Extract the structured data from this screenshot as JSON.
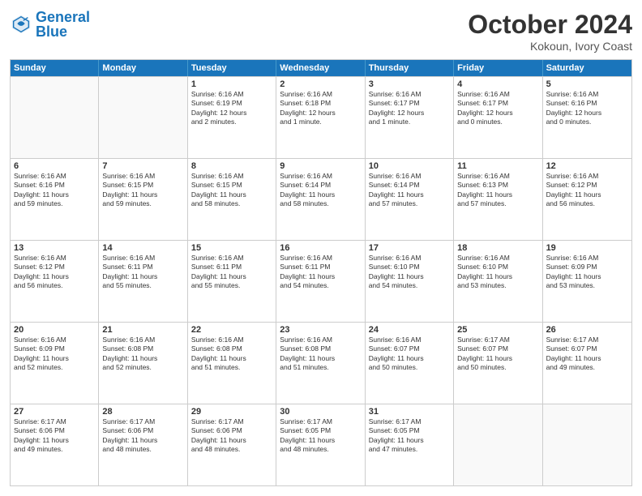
{
  "logo": {
    "line1": "General",
    "line2": "Blue"
  },
  "title": "October 2024",
  "subtitle": "Kokoun, Ivory Coast",
  "header_days": [
    "Sunday",
    "Monday",
    "Tuesday",
    "Wednesday",
    "Thursday",
    "Friday",
    "Saturday"
  ],
  "rows": [
    [
      {
        "day": "",
        "text": "",
        "empty": true
      },
      {
        "day": "",
        "text": "",
        "empty": true
      },
      {
        "day": "1",
        "text": "Sunrise: 6:16 AM\nSunset: 6:19 PM\nDaylight: 12 hours\nand 2 minutes."
      },
      {
        "day": "2",
        "text": "Sunrise: 6:16 AM\nSunset: 6:18 PM\nDaylight: 12 hours\nand 1 minute."
      },
      {
        "day": "3",
        "text": "Sunrise: 6:16 AM\nSunset: 6:17 PM\nDaylight: 12 hours\nand 1 minute."
      },
      {
        "day": "4",
        "text": "Sunrise: 6:16 AM\nSunset: 6:17 PM\nDaylight: 12 hours\nand 0 minutes."
      },
      {
        "day": "5",
        "text": "Sunrise: 6:16 AM\nSunset: 6:16 PM\nDaylight: 12 hours\nand 0 minutes."
      }
    ],
    [
      {
        "day": "6",
        "text": "Sunrise: 6:16 AM\nSunset: 6:16 PM\nDaylight: 11 hours\nand 59 minutes."
      },
      {
        "day": "7",
        "text": "Sunrise: 6:16 AM\nSunset: 6:15 PM\nDaylight: 11 hours\nand 59 minutes."
      },
      {
        "day": "8",
        "text": "Sunrise: 6:16 AM\nSunset: 6:15 PM\nDaylight: 11 hours\nand 58 minutes."
      },
      {
        "day": "9",
        "text": "Sunrise: 6:16 AM\nSunset: 6:14 PM\nDaylight: 11 hours\nand 58 minutes."
      },
      {
        "day": "10",
        "text": "Sunrise: 6:16 AM\nSunset: 6:14 PM\nDaylight: 11 hours\nand 57 minutes."
      },
      {
        "day": "11",
        "text": "Sunrise: 6:16 AM\nSunset: 6:13 PM\nDaylight: 11 hours\nand 57 minutes."
      },
      {
        "day": "12",
        "text": "Sunrise: 6:16 AM\nSunset: 6:12 PM\nDaylight: 11 hours\nand 56 minutes."
      }
    ],
    [
      {
        "day": "13",
        "text": "Sunrise: 6:16 AM\nSunset: 6:12 PM\nDaylight: 11 hours\nand 56 minutes."
      },
      {
        "day": "14",
        "text": "Sunrise: 6:16 AM\nSunset: 6:11 PM\nDaylight: 11 hours\nand 55 minutes."
      },
      {
        "day": "15",
        "text": "Sunrise: 6:16 AM\nSunset: 6:11 PM\nDaylight: 11 hours\nand 55 minutes."
      },
      {
        "day": "16",
        "text": "Sunrise: 6:16 AM\nSunset: 6:11 PM\nDaylight: 11 hours\nand 54 minutes."
      },
      {
        "day": "17",
        "text": "Sunrise: 6:16 AM\nSunset: 6:10 PM\nDaylight: 11 hours\nand 54 minutes."
      },
      {
        "day": "18",
        "text": "Sunrise: 6:16 AM\nSunset: 6:10 PM\nDaylight: 11 hours\nand 53 minutes."
      },
      {
        "day": "19",
        "text": "Sunrise: 6:16 AM\nSunset: 6:09 PM\nDaylight: 11 hours\nand 53 minutes."
      }
    ],
    [
      {
        "day": "20",
        "text": "Sunrise: 6:16 AM\nSunset: 6:09 PM\nDaylight: 11 hours\nand 52 minutes."
      },
      {
        "day": "21",
        "text": "Sunrise: 6:16 AM\nSunset: 6:08 PM\nDaylight: 11 hours\nand 52 minutes."
      },
      {
        "day": "22",
        "text": "Sunrise: 6:16 AM\nSunset: 6:08 PM\nDaylight: 11 hours\nand 51 minutes."
      },
      {
        "day": "23",
        "text": "Sunrise: 6:16 AM\nSunset: 6:08 PM\nDaylight: 11 hours\nand 51 minutes."
      },
      {
        "day": "24",
        "text": "Sunrise: 6:16 AM\nSunset: 6:07 PM\nDaylight: 11 hours\nand 50 minutes."
      },
      {
        "day": "25",
        "text": "Sunrise: 6:17 AM\nSunset: 6:07 PM\nDaylight: 11 hours\nand 50 minutes."
      },
      {
        "day": "26",
        "text": "Sunrise: 6:17 AM\nSunset: 6:07 PM\nDaylight: 11 hours\nand 49 minutes."
      }
    ],
    [
      {
        "day": "27",
        "text": "Sunrise: 6:17 AM\nSunset: 6:06 PM\nDaylight: 11 hours\nand 49 minutes."
      },
      {
        "day": "28",
        "text": "Sunrise: 6:17 AM\nSunset: 6:06 PM\nDaylight: 11 hours\nand 48 minutes."
      },
      {
        "day": "29",
        "text": "Sunrise: 6:17 AM\nSunset: 6:06 PM\nDaylight: 11 hours\nand 48 minutes."
      },
      {
        "day": "30",
        "text": "Sunrise: 6:17 AM\nSunset: 6:05 PM\nDaylight: 11 hours\nand 48 minutes."
      },
      {
        "day": "31",
        "text": "Sunrise: 6:17 AM\nSunset: 6:05 PM\nDaylight: 11 hours\nand 47 minutes."
      },
      {
        "day": "",
        "text": "",
        "empty": true
      },
      {
        "day": "",
        "text": "",
        "empty": true
      }
    ]
  ]
}
